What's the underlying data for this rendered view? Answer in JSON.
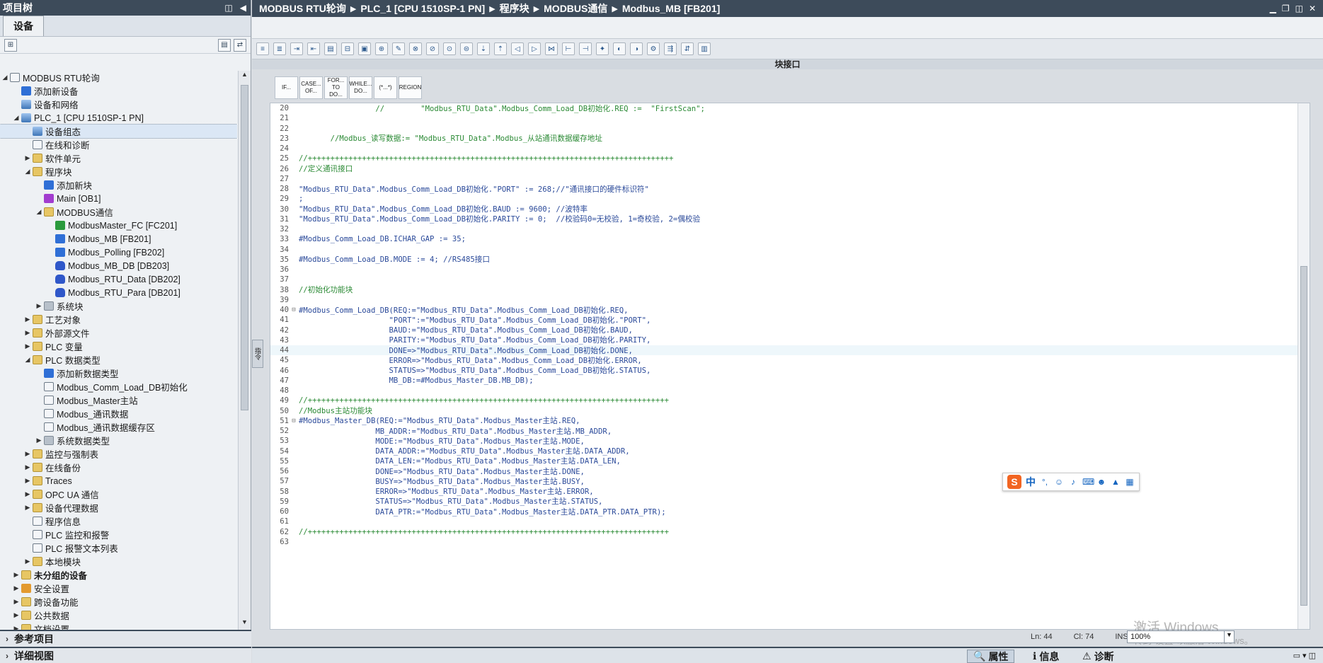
{
  "left_panel": {
    "title": "项目树",
    "tab": "设备",
    "tree": [
      {
        "label": "MODBUS RTU轮询",
        "arrow": "◢",
        "indent": 0,
        "icon": "tbl"
      },
      {
        "label": "添加新设备",
        "arrow": "",
        "indent": 1,
        "icon": "blue"
      },
      {
        "label": "设备和网络",
        "arrow": "",
        "indent": 1,
        "icon": "dev"
      },
      {
        "label": "PLC_1 [CPU 1510SP-1 PN]",
        "arrow": "◢",
        "indent": 1,
        "icon": "dev"
      },
      {
        "label": "设备组态",
        "arrow": "",
        "indent": 2,
        "icon": "dev",
        "selected": true
      },
      {
        "label": "在线和诊断",
        "arrow": "",
        "indent": 2,
        "icon": "tbl"
      },
      {
        "label": "软件单元",
        "arrow": "▶",
        "indent": 2,
        "icon": "folder"
      },
      {
        "label": "程序块",
        "arrow": "◢",
        "indent": 2,
        "icon": "folder"
      },
      {
        "label": "添加新块",
        "arrow": "",
        "indent": 3,
        "icon": "blue"
      },
      {
        "label": "Main [OB1]",
        "arrow": "",
        "indent": 3,
        "icon": "purple"
      },
      {
        "label": "MODBUS通信",
        "arrow": "◢",
        "indent": 3,
        "icon": "folder"
      },
      {
        "label": "ModbusMaster_FC [FC201]",
        "arrow": "",
        "indent": 4,
        "icon": "green"
      },
      {
        "label": "Modbus_MB [FB201]",
        "arrow": "",
        "indent": 4,
        "icon": "blue"
      },
      {
        "label": "Modbus_Polling [FB202]",
        "arrow": "",
        "indent": 4,
        "icon": "blue"
      },
      {
        "label": "Modbus_MB_DB [DB203]",
        "arrow": "",
        "indent": 4,
        "icon": "db"
      },
      {
        "label": "Modbus_RTU_Data [DB202]",
        "arrow": "",
        "indent": 4,
        "icon": "db"
      },
      {
        "label": "Modbus_RTU_Para [DB201]",
        "arrow": "",
        "indent": 4,
        "icon": "db"
      },
      {
        "label": "系统块",
        "arrow": "▶",
        "indent": 3,
        "icon": "gray"
      },
      {
        "label": "工艺对象",
        "arrow": "▶",
        "indent": 2,
        "icon": "folder"
      },
      {
        "label": "外部源文件",
        "arrow": "▶",
        "indent": 2,
        "icon": "folder"
      },
      {
        "label": "PLC 变量",
        "arrow": "▶",
        "indent": 2,
        "icon": "folder"
      },
      {
        "label": "PLC 数据类型",
        "arrow": "◢",
        "indent": 2,
        "icon": "folder"
      },
      {
        "label": "添加新数据类型",
        "arrow": "",
        "indent": 3,
        "icon": "blue"
      },
      {
        "label": "Modbus_Comm_Load_DB初始化",
        "arrow": "",
        "indent": 3,
        "icon": "tbl"
      },
      {
        "label": "Modbus_Master主站",
        "arrow": "",
        "indent": 3,
        "icon": "tbl"
      },
      {
        "label": "Modbus_通讯数据",
        "arrow": "",
        "indent": 3,
        "icon": "tbl"
      },
      {
        "label": "Modbus_通讯数据缓存区",
        "arrow": "",
        "indent": 3,
        "icon": "tbl"
      },
      {
        "label": "系统数据类型",
        "arrow": "▶",
        "indent": 3,
        "icon": "gray"
      },
      {
        "label": "监控与强制表",
        "arrow": "▶",
        "indent": 2,
        "icon": "folder"
      },
      {
        "label": "在线备份",
        "arrow": "▶",
        "indent": 2,
        "icon": "folder"
      },
      {
        "label": "Traces",
        "arrow": "▶",
        "indent": 2,
        "icon": "folder"
      },
      {
        "label": "OPC UA 通信",
        "arrow": "▶",
        "indent": 2,
        "icon": "folder"
      },
      {
        "label": "设备代理数据",
        "arrow": "▶",
        "indent": 2,
        "icon": "folder"
      },
      {
        "label": "程序信息",
        "arrow": "",
        "indent": 2,
        "icon": "tbl"
      },
      {
        "label": "PLC 监控和报警",
        "arrow": "",
        "indent": 2,
        "icon": "tbl"
      },
      {
        "label": "PLC 报警文本列表",
        "arrow": "",
        "indent": 2,
        "icon": "tbl"
      },
      {
        "label": "本地模块",
        "arrow": "▶",
        "indent": 2,
        "icon": "folder"
      },
      {
        "label": "未分组的设备",
        "arrow": "▶",
        "indent": 1,
        "icon": "folder",
        "bold": true
      },
      {
        "label": "安全设置",
        "arrow": "▶",
        "indent": 1,
        "icon": "orange"
      },
      {
        "label": "跨设备功能",
        "arrow": "▶",
        "indent": 1,
        "icon": "folder"
      },
      {
        "label": "公共数据",
        "arrow": "▶",
        "indent": 1,
        "icon": "folder"
      },
      {
        "label": "文档设置",
        "arrow": "▶",
        "indent": 1,
        "icon": "folder"
      }
    ],
    "bottom_ref": "参考项目",
    "bottom_detail": "详细视图"
  },
  "editor": {
    "breadcrumb": [
      "MODBUS RTU轮询",
      "PLC_1 [CPU 1510SP-1 PN]",
      "程序块",
      "MODBUS通信",
      "Modbus_MB [FB201]"
    ],
    "interface_label": "块接口",
    "side_tab": "指令",
    "instructions": [
      "IF...",
      "CASE... OF...",
      "FOR... TO DO...",
      "WHILE... DO...",
      "(*...*)",
      "REGION"
    ],
    "lines": [
      {
        "n": "20",
        "t": "                 //        \"Modbus_RTU_Data\".Modbus_Comm_Load_DB初始化.REQ :=  \"FirstScan\";",
        "c": "cmt"
      },
      {
        "n": "21",
        "t": ""
      },
      {
        "n": "22",
        "t": ""
      },
      {
        "n": "23",
        "t": "       //Modbus_读写数据:= \"Modbus_RTU_Data\".Modbus_从站通讯数据缓存地址",
        "c": "cmt"
      },
      {
        "n": "24",
        "t": ""
      },
      {
        "n": "25",
        "t": "//+++++++++++++++++++++++++++++++++++++++++++++++++++++++++++++++++++++++++++++++++",
        "c": "cmt"
      },
      {
        "n": "26",
        "t": "//定义通讯接口",
        "c": "cmt"
      },
      {
        "n": "27",
        "t": ""
      },
      {
        "n": "28",
        "t": "\"Modbus_RTU_Data\".Modbus_Comm_Load_DB初始化.\"PORT\" := 268;//\"通讯接口的硬件标识符\""
      },
      {
        "n": "29",
        "t": ";"
      },
      {
        "n": "30",
        "t": "\"Modbus_RTU_Data\".Modbus_Comm_Load_DB初始化.BAUD := 9600; //波特率"
      },
      {
        "n": "31",
        "t": "\"Modbus_RTU_Data\".Modbus_Comm_Load_DB初始化.PARITY := 0;  //校验码0=无校验, 1=奇校验, 2=偶校验"
      },
      {
        "n": "32",
        "t": ""
      },
      {
        "n": "33",
        "t": "#Modbus_Comm_Load_DB.ICHAR_GAP := 35;"
      },
      {
        "n": "34",
        "t": ""
      },
      {
        "n": "35",
        "t": "#Modbus_Comm_Load_DB.MODE := 4; //RS485接口"
      },
      {
        "n": "36",
        "t": ""
      },
      {
        "n": "37",
        "t": ""
      },
      {
        "n": "38",
        "t": "//初始化功能块",
        "c": "cmt"
      },
      {
        "n": "39",
        "t": ""
      },
      {
        "n": "40",
        "t": "#Modbus_Comm_Load_DB(REQ:=\"Modbus_RTU_Data\".Modbus_Comm_Load_DB初始化.REQ,",
        "fold": "⊟"
      },
      {
        "n": "41",
        "t": "                    \"PORT\":=\"Modbus_RTU_Data\".Modbus_Comm_Load_DB初始化.\"PORT\","
      },
      {
        "n": "42",
        "t": "                    BAUD:=\"Modbus_RTU_Data\".Modbus_Comm_Load_DB初始化.BAUD,"
      },
      {
        "n": "43",
        "t": "                    PARITY:=\"Modbus_RTU_Data\".Modbus_Comm_Load_DB初始化.PARITY,"
      },
      {
        "n": "44",
        "t": "                    DONE=>\"Modbus_RTU_Data\".Modbus_Comm_Load_DB初始化.DONE,",
        "hl": true
      },
      {
        "n": "45",
        "t": "                    ERROR=>\"Modbus_RTU_Data\".Modbus_Comm_Load_DB初始化.ERROR,"
      },
      {
        "n": "46",
        "t": "                    STATUS=>\"Modbus_RTU_Data\".Modbus_Comm_Load_DB初始化.STATUS,"
      },
      {
        "n": "47",
        "t": "                    MB_DB:=#Modbus_Master_DB.MB_DB);"
      },
      {
        "n": "48",
        "t": ""
      },
      {
        "n": "49",
        "t": "//++++++++++++++++++++++++++++++++++++++++++++++++++++++++++++++++++++++++++++++++",
        "c": "cmt"
      },
      {
        "n": "50",
        "t": "//Modbus主站功能块",
        "c": "cmt"
      },
      {
        "n": "51",
        "t": "#Modbus_Master_DB(REQ:=\"Modbus_RTU_Data\".Modbus_Master主站.REQ,",
        "fold": "⊟"
      },
      {
        "n": "52",
        "t": "                 MB_ADDR:=\"Modbus_RTU_Data\".Modbus_Master主站.MB_ADDR,"
      },
      {
        "n": "53",
        "t": "                 MODE:=\"Modbus_RTU_Data\".Modbus_Master主站.MODE,"
      },
      {
        "n": "54",
        "t": "                 DATA_ADDR:=\"Modbus_RTU_Data\".Modbus_Master主站.DATA_ADDR,"
      },
      {
        "n": "55",
        "t": "                 DATA_LEN:=\"Modbus_RTU_Data\".Modbus_Master主站.DATA_LEN,"
      },
      {
        "n": "56",
        "t": "                 DONE=>\"Modbus_RTU_Data\".Modbus_Master主站.DONE,"
      },
      {
        "n": "57",
        "t": "                 BUSY=>\"Modbus_RTU_Data\".Modbus_Master主站.BUSY,"
      },
      {
        "n": "58",
        "t": "                 ERROR=>\"Modbus_RTU_Data\".Modbus_Master主站.ERROR,"
      },
      {
        "n": "59",
        "t": "                 STATUS=>\"Modbus_RTU_Data\".Modbus_Master主站.STATUS,"
      },
      {
        "n": "60",
        "t": "                 DATA_PTR:=\"Modbus_RTU_Data\".Modbus_Master主站.DATA_PTR.DATA_PTR);"
      },
      {
        "n": "61",
        "t": ""
      },
      {
        "n": "62",
        "t": "//++++++++++++++++++++++++++++++++++++++++++++++++++++++++++++++++++++++++++++++++",
        "c": "cmt"
      },
      {
        "n": "63",
        "t": ""
      }
    ],
    "status": {
      "ln": "Ln: 44",
      "cl": "Cl: 74",
      "mode": "INS"
    },
    "zoom": "100%",
    "watermark_line1": "激活 Windows",
    "watermark_line2": "转到\"设置\"以激活 Windows。",
    "ime_label": "中"
  },
  "bottom_tabs": {
    "properties": "属性",
    "info": "信息",
    "diagnostics": "诊断"
  },
  "colors": {
    "titlebar": "#3d4b5a",
    "code": "#2b4a9a",
    "comment": "#2b8a35"
  }
}
